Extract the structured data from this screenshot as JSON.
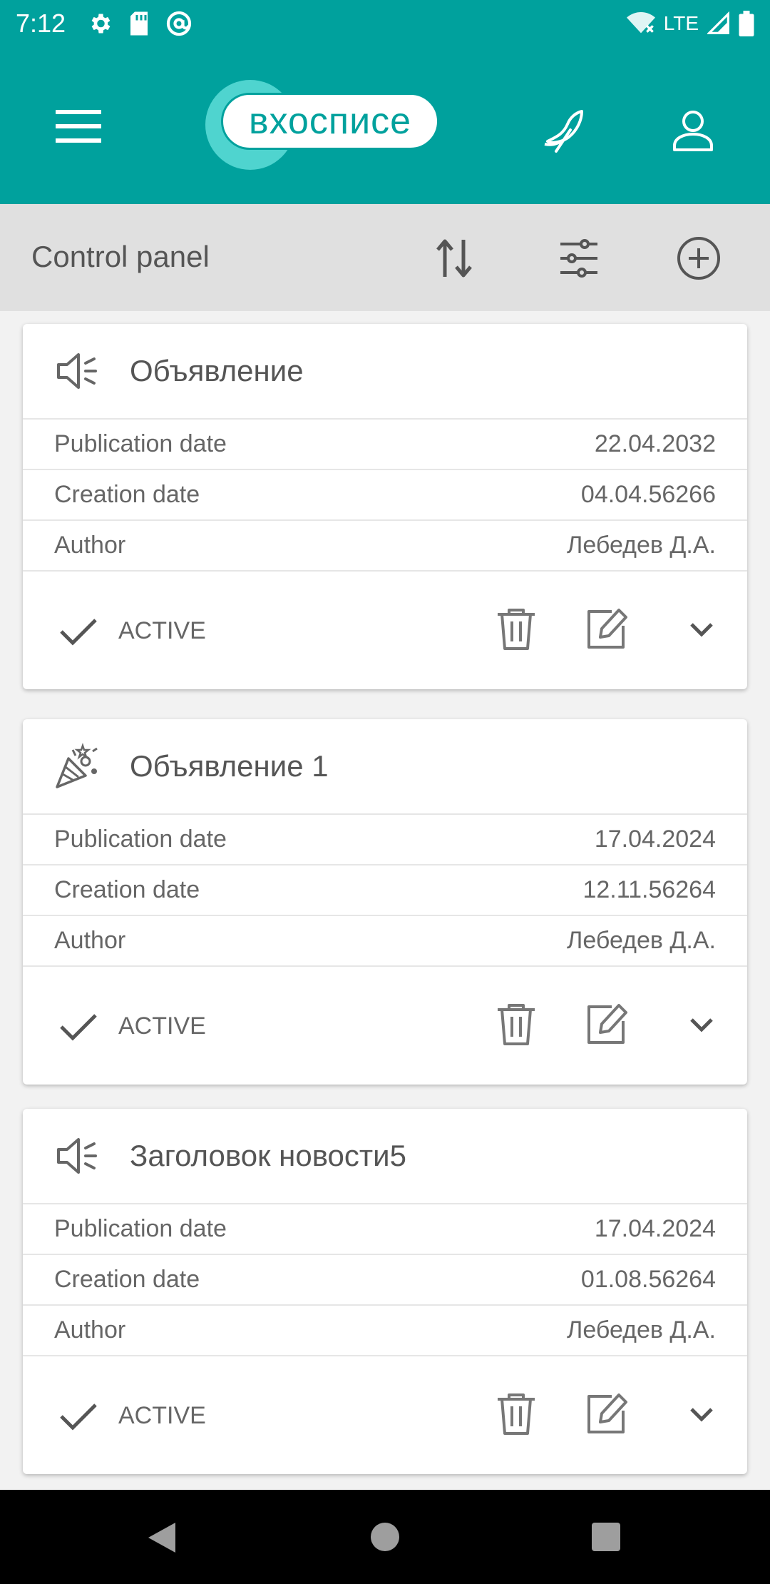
{
  "status_bar": {
    "time": "7:12",
    "network": "LTE",
    "icons": [
      "gear-icon",
      "sd-card-icon",
      "at-sign-icon",
      "wifi-icon",
      "signal-icon",
      "battery-icon"
    ]
  },
  "app_bar": {
    "logo_text": "вхосписе",
    "icons": [
      "menu-icon",
      "feather-icon",
      "user-icon"
    ]
  },
  "control_panel": {
    "title": "Control panel",
    "icons": [
      "sort-icon",
      "filter-icon",
      "add-circle-icon"
    ]
  },
  "cards": [
    {
      "type_icon": "megaphone-icon",
      "title": "Объявление",
      "rows": [
        {
          "label": "Publication date",
          "value": "22.04.2032"
        },
        {
          "label": "Creation date",
          "value": "04.04.56266"
        },
        {
          "label": "Author",
          "value": "Лебедев Д.А."
        }
      ],
      "status": "ACTIVE"
    },
    {
      "type_icon": "party-popper-icon",
      "title": "Объявление 1",
      "rows": [
        {
          "label": "Publication date",
          "value": "17.04.2024"
        },
        {
          "label": "Creation date",
          "value": "12.11.56264"
        },
        {
          "label": "Author",
          "value": "Лебедев Д.А."
        }
      ],
      "status": "ACTIVE"
    },
    {
      "type_icon": "megaphone-icon",
      "title": "Заголовок новости5",
      "rows": [
        {
          "label": "Publication date",
          "value": "17.04.2024"
        },
        {
          "label": "Creation date",
          "value": "01.08.56264"
        },
        {
          "label": "Author",
          "value": "Лебедев Д.А."
        }
      ],
      "status": "ACTIVE"
    }
  ],
  "colors": {
    "primary": "#00a19d",
    "control_bar": "#e0e0e0",
    "text": "#555555"
  }
}
